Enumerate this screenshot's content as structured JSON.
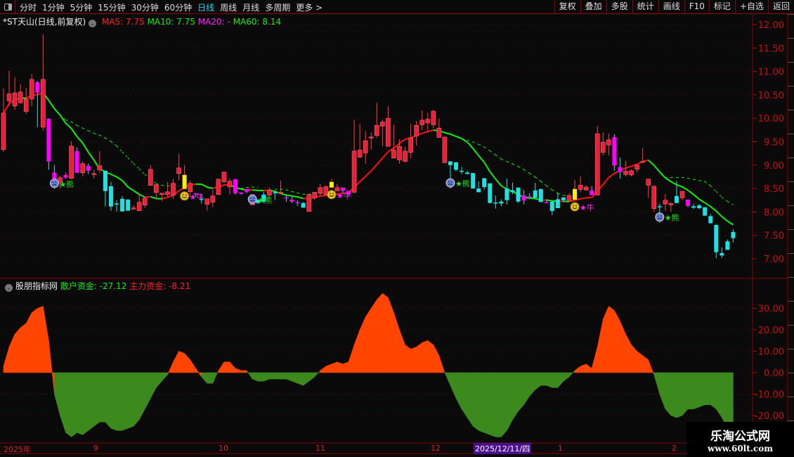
{
  "toolbar": {
    "periods": [
      "分时",
      "1分钟",
      "5分钟",
      "15分钟",
      "30分钟",
      "60分钟",
      "日线",
      "周线",
      "月线",
      "多周期",
      "更多 >"
    ],
    "active_period": "日线",
    "buttons": [
      "复权",
      "叠加",
      "多股",
      "统计",
      "画线",
      "F10",
      "标记",
      "+自选",
      "返回"
    ]
  },
  "info": {
    "stock": "*ST天山(日线,前复权)",
    "ma5": "MA5: 7.75",
    "ma10": "MA10: 7.75",
    "ma20": "MA20: -",
    "ma60": "MA60: 8.14"
  },
  "indicator": {
    "name": "股朋指标网",
    "retail": "散户资金: -27.12",
    "main": "主力资金: -8.21"
  },
  "price_axis": [
    "12.00",
    "11.50",
    "11.00",
    "10.50",
    "10.00",
    "9.50",
    "9.00",
    "8.50",
    "8.00",
    "7.50",
    "7.00"
  ],
  "ind_axis": [
    "30.00",
    "20.00",
    "10.00",
    "0.00",
    "-10.00",
    "-20.00"
  ],
  "x_axis": {
    "labels": [
      "2025年",
      "9",
      "10",
      "11",
      "12",
      "1",
      "2"
    ],
    "cursor_date": "2025/12/11/四"
  },
  "markers": {
    "bear": "★熊",
    "bull": "★牛",
    "bear_index": [
      9,
      44,
      79,
      116
    ],
    "bull_index": [
      32,
      58,
      101
    ]
  },
  "colors": {
    "up": "#e8203a",
    "down": "#22e0e0",
    "highlight": "#ff00ff",
    "signal": "#ffee00",
    "ma_up": "#ff1010",
    "ma_down": "#10ee10",
    "pos_area": "#ff4500",
    "neg_area": "#3c8a1e",
    "axis": "#8b0000"
  },
  "watermark": {
    "line1": "乐淘公式网",
    "line2": "www.60lt.com"
  },
  "chart_data": [
    {
      "type": "candlestick",
      "ylim": [
        7.0,
        12.0
      ],
      "highlight_magenta": [
        6,
        8,
        9,
        11,
        13,
        15,
        34,
        41,
        42,
        43,
        50,
        51,
        52,
        60,
        61,
        92,
        93,
        96,
        104,
        108,
        109,
        121
      ],
      "highlight_yellow": [
        32,
        58,
        101
      ],
      "ohlc": [
        [
          9.33,
          10.64,
          9.28,
          10.11
        ],
        [
          10.37,
          11.01,
          10.26,
          10.52
        ],
        [
          10.26,
          10.875,
          10.175,
          10.54
        ],
        [
          10.33,
          10.725,
          10.31,
          10.56
        ],
        [
          10.145,
          10.65,
          10.085,
          10.41
        ],
        [
          10.41,
          10.95,
          10.26,
          10.83
        ],
        [
          10.77,
          10.8,
          9.81,
          10.545
        ],
        [
          9.81,
          11.79,
          9.735,
          10.83
        ],
        [
          9.99,
          10.0,
          8.9,
          9.075
        ],
        [
          8.84,
          9.0,
          8.49,
          8.64
        ],
        [
          8.625,
          8.775,
          8.505,
          8.73
        ],
        [
          8.73,
          8.85,
          8.7,
          8.79
        ],
        [
          8.715,
          9.51,
          8.7,
          9.405
        ],
        [
          9.3,
          9.375,
          8.835,
          8.835
        ],
        [
          8.835,
          9.075,
          8.76,
          9.03
        ],
        [
          8.985,
          9.03,
          8.805,
          8.88
        ],
        [
          8.81,
          8.895,
          8.715,
          8.82
        ],
        [
          8.895,
          9.3,
          8.835,
          8.985
        ],
        [
          8.88,
          8.88,
          8.115,
          8.445
        ],
        [
          8.55,
          8.64,
          8.025,
          8.115
        ],
        [
          8.18,
          8.25,
          8.01,
          8.17
        ],
        [
          8.28,
          8.34,
          8.01,
          8.01
        ],
        [
          8.265,
          8.265,
          8.025,
          8.025
        ],
        [
          8.07,
          8.145,
          8.04,
          8.085
        ],
        [
          8.025,
          8.37,
          8.025,
          8.205
        ],
        [
          8.145,
          8.295,
          8.085,
          8.295
        ],
        [
          8.565,
          9.0,
          8.565,
          8.91
        ],
        [
          8.415,
          8.61,
          8.28,
          8.58
        ],
        [
          8.37,
          8.4,
          8.235,
          8.4
        ],
        [
          8.37,
          8.64,
          8.325,
          8.43
        ],
        [
          8.355,
          8.7,
          8.28,
          8.61
        ],
        [
          8.82,
          9.24,
          8.67,
          8.94
        ],
        [
          8.49,
          9.0,
          8.49,
          8.79
        ],
        [
          8.43,
          8.67,
          8.325,
          8.61
        ],
        [
          8.4,
          8.4,
          8.32,
          8.37
        ],
        [
          8.28,
          8.385,
          8.175,
          8.27
        ],
        [
          8.16,
          8.28,
          8.025,
          8.28
        ],
        [
          8.205,
          8.475,
          8.1,
          8.34
        ],
        [
          8.37,
          8.7,
          8.37,
          8.7
        ],
        [
          8.64,
          8.865,
          8.625,
          8.85
        ],
        [
          8.535,
          8.715,
          8.37,
          8.655
        ],
        [
          8.7,
          8.7,
          8.37,
          8.4
        ],
        [
          8.415,
          8.415,
          8.37,
          8.385
        ],
        [
          8.49,
          8.49,
          8.4,
          8.43
        ],
        [
          8.15,
          8.37,
          8.15,
          8.37
        ],
        [
          8.26,
          8.27,
          8.17,
          8.19
        ],
        [
          8.37,
          8.43,
          8.19,
          8.22
        ],
        [
          8.36,
          8.52,
          8.33,
          8.46
        ],
        [
          8.42,
          8.46,
          8.26,
          8.41
        ],
        [
          8.4,
          8.67,
          8.4,
          8.42
        ],
        [
          8.31,
          8.37,
          8.22,
          8.3
        ],
        [
          8.26,
          8.32,
          8.19,
          8.22
        ],
        [
          8.21,
          8.25,
          8.13,
          8.19
        ],
        [
          8.19,
          8.21,
          8.09,
          8.09
        ],
        [
          8.01,
          8.37,
          8.01,
          8.37
        ],
        [
          8.3,
          8.42,
          8.25,
          8.42
        ],
        [
          8.4,
          8.6,
          8.35,
          8.52
        ],
        [
          8.37,
          8.57,
          8.35,
          8.54
        ],
        [
          8.52,
          8.7,
          8.52,
          8.64
        ],
        [
          8.45,
          8.6,
          8.45,
          8.52
        ],
        [
          8.52,
          8.52,
          8.4,
          8.45
        ],
        [
          8.45,
          8.45,
          8.35,
          8.37
        ],
        [
          8.42,
          9.97,
          8.4,
          9.3
        ],
        [
          9.17,
          9.88,
          9.15,
          9.32
        ],
        [
          9.26,
          9.73,
          9.03,
          9.52
        ],
        [
          9.58,
          9.7,
          9.33,
          9.6
        ],
        [
          9.63,
          10.33,
          9.58,
          9.85
        ],
        [
          9.83,
          9.97,
          9.4,
          9.92
        ],
        [
          9.4,
          10.26,
          9.4,
          10.0
        ],
        [
          9.15,
          9.86,
          9.15,
          9.32
        ],
        [
          9.11,
          9.55,
          9.03,
          9.4
        ],
        [
          9.08,
          9.39,
          9.06,
          9.3
        ],
        [
          9.27,
          9.88,
          9.15,
          9.58
        ],
        [
          9.62,
          9.94,
          9.42,
          9.85
        ],
        [
          9.86,
          10.17,
          9.75,
          9.96
        ],
        [
          9.9,
          10.12,
          9.72,
          9.98
        ],
        [
          9.86,
          10.18,
          9.78,
          10.15
        ],
        [
          9.59,
          9.99,
          9.59,
          9.79
        ],
        [
          9.05,
          9.6,
          9.05,
          9.6
        ],
        [
          9.08,
          9.08,
          8.5,
          9.0
        ],
        [
          9.06,
          9.06,
          8.87,
          8.9
        ],
        [
          8.88,
          8.96,
          8.81,
          8.87
        ],
        [
          8.84,
          8.88,
          8.8,
          8.81
        ],
        [
          8.83,
          8.83,
          8.5,
          8.5
        ],
        [
          8.5,
          8.65,
          8.42,
          8.42
        ],
        [
          8.72,
          8.72,
          8.48,
          8.53
        ],
        [
          8.61,
          8.61,
          8.19,
          8.19
        ],
        [
          8.2,
          8.35,
          8.07,
          8.19
        ],
        [
          8.22,
          8.27,
          8.12,
          8.18
        ],
        [
          8.5,
          8.71,
          8.16,
          8.25
        ],
        [
          8.46,
          8.63,
          8.38,
          8.42
        ],
        [
          8.52,
          8.52,
          8.19,
          8.22
        ],
        [
          8.35,
          8.47,
          8.16,
          8.24
        ],
        [
          8.33,
          8.4,
          8.3,
          8.32
        ],
        [
          8.46,
          8.62,
          8.3,
          8.3
        ],
        [
          8.49,
          8.49,
          8.21,
          8.21
        ],
        [
          8.21,
          8.27,
          8.19,
          8.2
        ],
        [
          8.22,
          8.22,
          7.93,
          8.02
        ],
        [
          8.27,
          8.41,
          8.08,
          8.08
        ],
        [
          8.31,
          8.31,
          8.2,
          8.25
        ],
        [
          8.24,
          8.4,
          8.24,
          8.35
        ],
        [
          8.26,
          8.68,
          8.26,
          8.49
        ],
        [
          8.48,
          8.76,
          8.42,
          8.57
        ],
        [
          8.47,
          8.57,
          8.45,
          8.53
        ],
        [
          8.46,
          8.55,
          8.36,
          8.36
        ],
        [
          8.36,
          9.84,
          8.36,
          9.67
        ],
        [
          9.27,
          9.7,
          9.21,
          9.49
        ],
        [
          9.43,
          9.67,
          9.21,
          9.54
        ],
        [
          9.6,
          9.66,
          8.88,
          8.99
        ],
        [
          8.96,
          9.16,
          8.71,
          8.85
        ],
        [
          8.8,
          9.09,
          8.76,
          8.87
        ],
        [
          8.79,
          8.91,
          8.76,
          8.88
        ],
        [
          8.91,
          9.0,
          8.85,
          9.0
        ],
        [
          9.06,
          9.36,
          9.05,
          9.08
        ],
        [
          8.57,
          8.7,
          8.3,
          8.7
        ],
        [
          8.07,
          8.55,
          8.01,
          8.55
        ],
        [
          8.12,
          8.17,
          7.77,
          8.1
        ],
        [
          8.17,
          8.38,
          8.02,
          8.25
        ],
        [
          8.15,
          8.2,
          8.0,
          8.18
        ],
        [
          8.34,
          8.66,
          8.19,
          8.19
        ],
        [
          8.3,
          8.44,
          8.25,
          8.44
        ],
        [
          8.26,
          8.27,
          8.1,
          8.13
        ],
        [
          8.12,
          8.17,
          8.06,
          8.09
        ],
        [
          8.14,
          8.17,
          8.06,
          8.08
        ],
        [
          8.1,
          8.1,
          7.92,
          7.92
        ],
        [
          7.91,
          7.96,
          7.75,
          7.76
        ],
        [
          7.72,
          7.74,
          7.01,
          7.14
        ],
        [
          7.12,
          7.24,
          7.02,
          7.07
        ],
        [
          7.37,
          7.41,
          7.19,
          7.19
        ],
        [
          7.57,
          7.63,
          7.35,
          7.44
        ]
      ]
    },
    {
      "type": "area",
      "name": "散户资金",
      "ylim": [
        -30,
        40
      ],
      "values": [
        3,
        12,
        18,
        21,
        23,
        28,
        30,
        31,
        15,
        -10,
        -20,
        -28,
        -30,
        -28,
        -29,
        -27,
        -25,
        -23,
        -23,
        -26,
        -27,
        -27,
        -26,
        -25,
        -22,
        -17,
        -12,
        -7,
        -4,
        -1,
        5,
        10,
        9,
        6,
        2,
        -2,
        -5,
        -5,
        1,
        5,
        5,
        2,
        1,
        1,
        -3,
        -4,
        -4,
        -3,
        -3,
        -3,
        -3,
        -4,
        -5,
        -6,
        -4,
        -2,
        1,
        3,
        4,
        5,
        4,
        5,
        13,
        20,
        26,
        30,
        34,
        37,
        35,
        28,
        20,
        13,
        11,
        12,
        14,
        15,
        13,
        8,
        0,
        -6,
        -12,
        -17,
        -21,
        -25,
        -27,
        -28,
        -29,
        -30,
        -30,
        -27,
        -22,
        -18,
        -15,
        -11,
        -8,
        -6,
        -6,
        -7,
        -7,
        -4,
        -2,
        1,
        3,
        4,
        2,
        12,
        25,
        31,
        29,
        24,
        18,
        13,
        10,
        8,
        6,
        -1,
        -10,
        -17,
        -20,
        -21,
        -20,
        -17,
        -17,
        -16,
        -15,
        -15,
        -17,
        -21,
        -26,
        -27.12
      ]
    }
  ]
}
